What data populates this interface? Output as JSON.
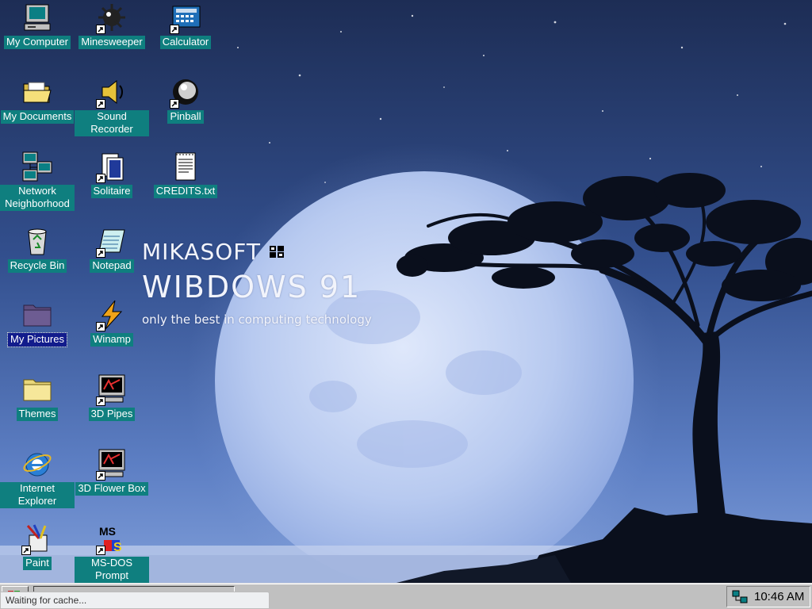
{
  "brand": {
    "company": "MIKASOFT",
    "product": "WIBDOWS 91",
    "tagline": "only the best in computing technology"
  },
  "desktop_icons": [
    {
      "label": "My Computer",
      "icon": "my-computer-icon"
    },
    {
      "label": "Minesweeper",
      "icon": "minesweeper-icon"
    },
    {
      "label": "Calculator",
      "icon": "calculator-icon"
    },
    {
      "label": "My Documents",
      "icon": "open-folder-icon"
    },
    {
      "label": "Sound Recorder",
      "icon": "sound-recorder-icon"
    },
    {
      "label": "Pinball",
      "icon": "pinball-icon"
    },
    {
      "label": "Network Neighborhood",
      "icon": "network-icon"
    },
    {
      "label": "Solitaire",
      "icon": "solitaire-icon"
    },
    {
      "label": "CREDITS.txt",
      "icon": "text-file-icon"
    },
    {
      "label": "Recycle Bin",
      "icon": "recycle-bin-icon"
    },
    {
      "label": "Notepad",
      "icon": "notepad-icon"
    },
    {
      "label": "My Pictures",
      "icon": "folder-icon",
      "selected": true
    },
    {
      "label": "Winamp",
      "icon": "winamp-icon"
    },
    {
      "label": "Themes",
      "icon": "folder-icon"
    },
    {
      "label": "3D Pipes",
      "icon": "screensaver-icon"
    },
    {
      "label": "Internet Explorer",
      "icon": "internet-explorer-icon"
    },
    {
      "label": "3D Flower Box",
      "icon": "screensaver-icon"
    },
    {
      "label": "Paint",
      "icon": "paint-icon"
    },
    {
      "label": "MS-DOS Prompt",
      "icon": "ms-dos-icon"
    }
  ],
  "taskbar": {
    "clock": "10:46 AM"
  },
  "status": {
    "text": "Waiting for cache..."
  },
  "colors": {
    "label_bg": "#0f7f7f",
    "selected_label_bg": "#121c8c",
    "taskbar": "#c0c0c0"
  }
}
